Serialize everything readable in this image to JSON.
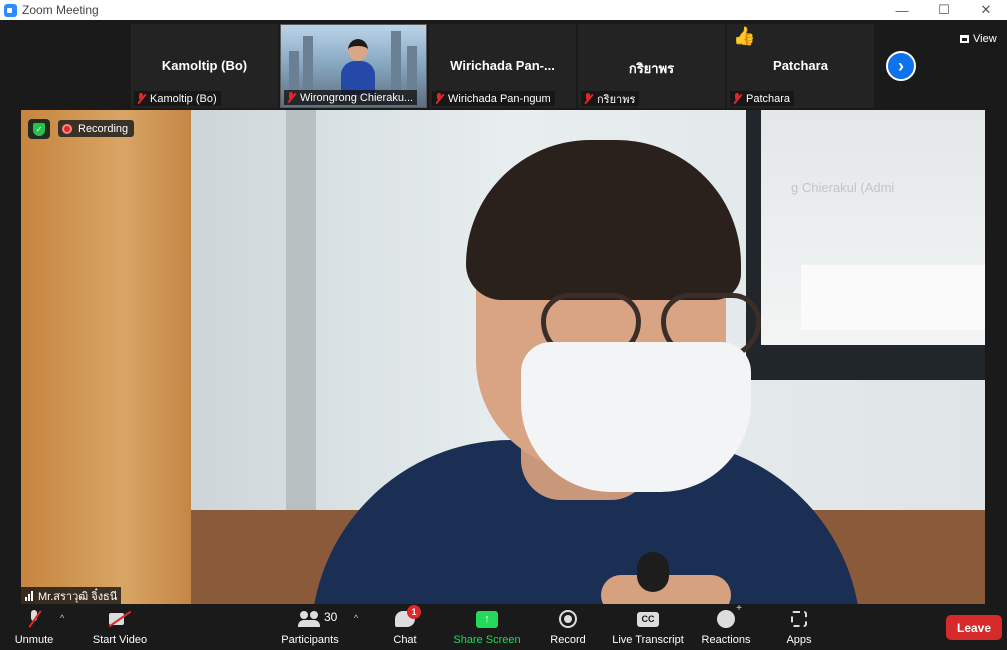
{
  "window": {
    "title": "Zoom Meeting"
  },
  "gallery": {
    "tiles": [
      {
        "display_name": "Kamoltip (Bo)",
        "label": "Kamoltip (Bo)"
      },
      {
        "display_name": "",
        "label": "Wirongrong Chieraku..."
      },
      {
        "display_name": "Wirichada  Pan-...",
        "label": "Wirichada Pan-ngum"
      },
      {
        "display_name": "กริยาพร",
        "label": "กริยาพร"
      },
      {
        "display_name": "Patchara",
        "label": "Patchara"
      }
    ],
    "view_label": "View"
  },
  "main_video": {
    "recording_label": "Recording",
    "speaker_label": "Mr.สราวุฒิ จิ๋งธนี",
    "background_screen_text": "g Chierakul (Admi"
  },
  "toolbar": {
    "unmute": "Unmute",
    "start_video": "Start Video",
    "participants": "Participants",
    "participants_count": "30",
    "chat": "Chat",
    "chat_badge": "1",
    "share_screen": "Share Screen",
    "share_icon_glyph": "↑",
    "record": "Record",
    "live_transcript": "Live Transcript",
    "cc_glyph": "CC",
    "reactions": "Reactions",
    "apps": "Apps",
    "leave": "Leave"
  },
  "colors": {
    "accent_blue": "#0e72ed",
    "share_green": "#23d959",
    "leave_red": "#d6292a",
    "mute_red": "#e02828"
  }
}
